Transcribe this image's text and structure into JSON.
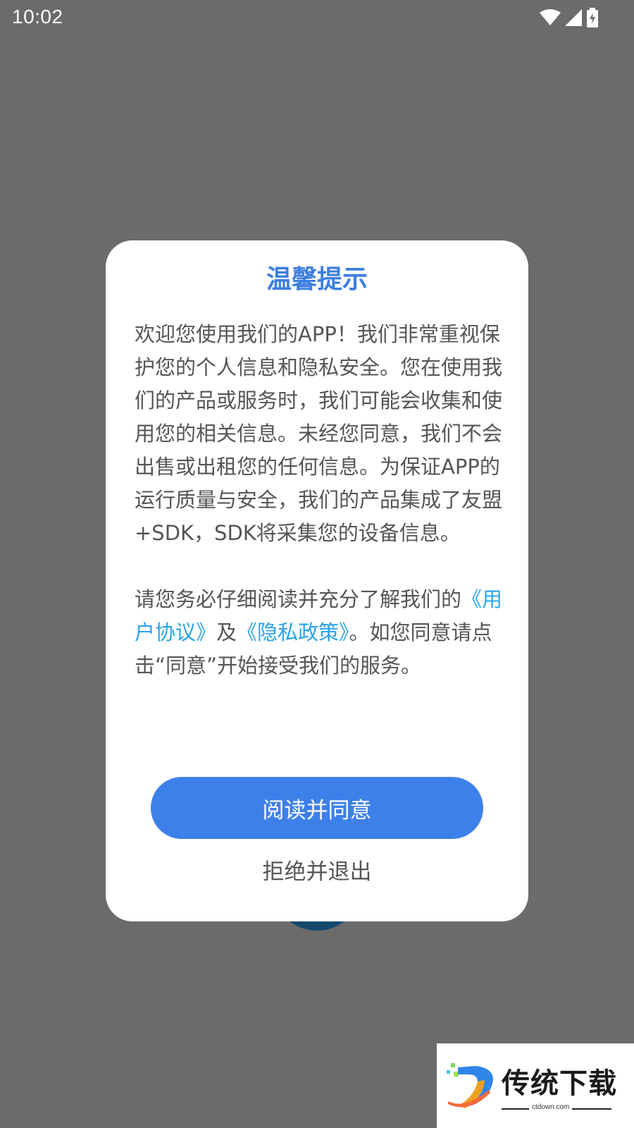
{
  "status_bar": {
    "time": "10:02",
    "icons": [
      "wifi-icon",
      "cellular-signal-icon",
      "battery-charging-icon"
    ]
  },
  "dialog": {
    "title": "温馨提示",
    "paragraph1": "欢迎您使用我们的APP！我们非常重视保护您的个人信息和隐私安全。您在使用我们的产品或服务时，我们可能会收集和使用您的相关信息。未经您同意，我们不会出售或出租您的任何信息。为保证APP的运行质量与安全，我们的产品集成了友盟+SDK，SDK将采集您的设备信息。",
    "paragraph2": {
      "text_before": "请您务必仔细阅读并充分了解我们的",
      "user_agreement_link": "《用户协议》",
      "conjunction": "及",
      "privacy_policy_link": "《隐私政策》",
      "text_after": "。如您同意请点击“同意”开始接受我们的服务。"
    },
    "agree_button": "阅读并同意",
    "reject_button": "拒绝并退出"
  },
  "watermark": {
    "brand": "传统下载",
    "domain": "ctdown.com"
  },
  "colors": {
    "overlay": "#6b6b6b",
    "title": "#3c7ee0",
    "primary_button": "#3e80ea",
    "link": "#2aa3e8",
    "body_text": "#555555"
  }
}
